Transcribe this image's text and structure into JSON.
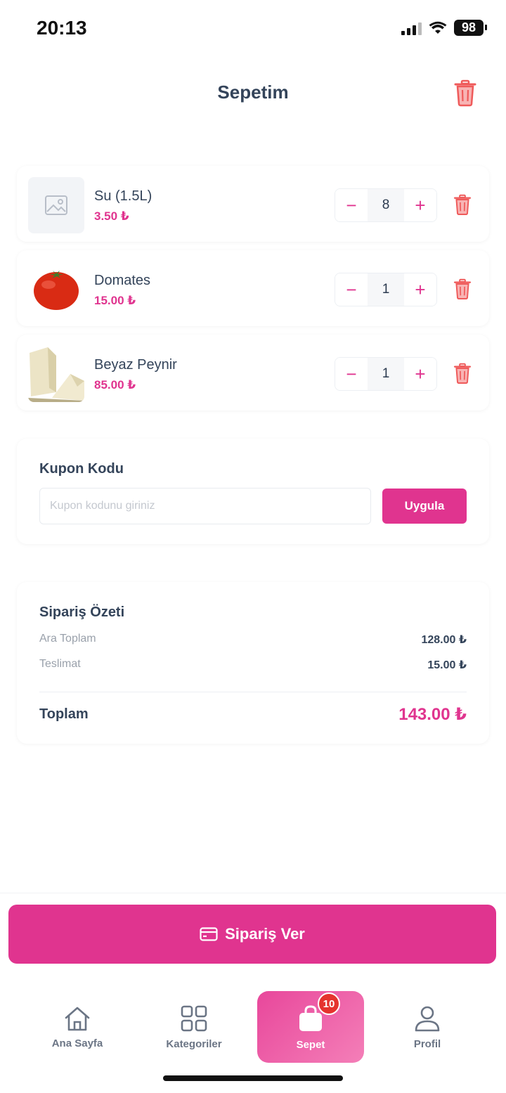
{
  "status_bar": {
    "time": "20:13",
    "battery": "98"
  },
  "header": {
    "title": "Sepetim"
  },
  "cart": {
    "items": [
      {
        "name": "Su (1.5L)",
        "price": "3.50 ₺",
        "quantity": "8",
        "image": "placeholder-image-icon"
      },
      {
        "name": "Domates",
        "price": "15.00 ₺",
        "quantity": "1",
        "image": "tomato"
      },
      {
        "name": "Beyaz Peynir",
        "price": "85.00 ₺",
        "quantity": "1",
        "image": "white-cheese"
      }
    ],
    "minus": "−",
    "plus": "+"
  },
  "coupon": {
    "title": "Kupon Kodu",
    "placeholder": "Kupon kodunu giriniz",
    "value": "",
    "apply_label": "Uygula"
  },
  "summary": {
    "title": "Sipariş Özeti",
    "subtotal_label": "Ara Toplam",
    "subtotal_value": "128.00 ₺",
    "delivery_label": "Teslimat",
    "delivery_value": "15.00 ₺",
    "total_label": "Toplam",
    "total_value": "143.00 ₺"
  },
  "checkout": {
    "label": "Sipariş Ver"
  },
  "tabs": [
    {
      "label": "Ana Sayfa",
      "icon": "home-icon"
    },
    {
      "label": "Kategoriler",
      "icon": "grid-icon"
    },
    {
      "label": "Sepet",
      "icon": "shopping-bag-icon",
      "badge": "10",
      "active": true
    },
    {
      "label": "Profil",
      "icon": "user-icon"
    }
  ],
  "colors": {
    "accent": "#e0348f",
    "danger": "#e5332e",
    "text": "#34445a"
  }
}
